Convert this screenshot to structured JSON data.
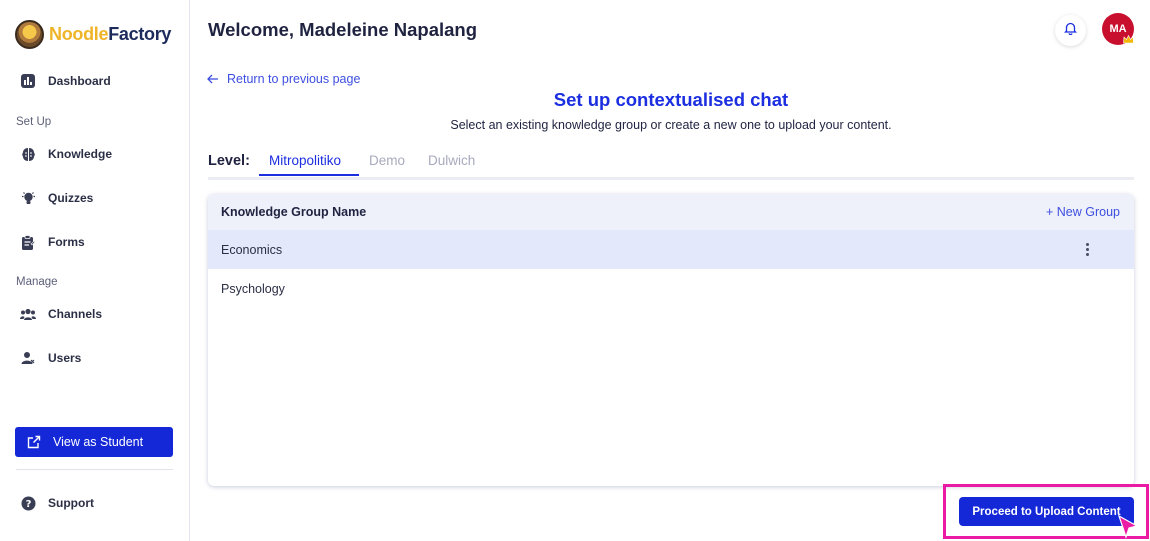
{
  "brand": {
    "name_part1": "Noodle",
    "name_part2": "Factory"
  },
  "sidebar": {
    "dashboard": "Dashboard",
    "setup_label": "Set Up",
    "knowledge": "Knowledge",
    "quizzes": "Quizzes",
    "forms": "Forms",
    "manage_label": "Manage",
    "channels": "Channels",
    "users": "Users",
    "view_as_student": "View as Student",
    "support": "Support"
  },
  "header": {
    "welcome": "Welcome, Madeleine Napalang",
    "avatar_initials": "MA"
  },
  "main": {
    "back_link": "Return to previous page",
    "title": "Set up contextualised chat",
    "subtitle": "Select an existing knowledge group or create a new one to upload your content.",
    "level_label": "Level:",
    "tabs": [
      "Mitropolitiko",
      "Demo",
      "Dulwich"
    ],
    "active_tab": "Mitropolitiko",
    "table": {
      "column_header": "Knowledge Group Name",
      "new_group": "+ New Group",
      "rows": [
        "Economics",
        "Psychology"
      ],
      "selected_row": "Economics"
    },
    "proceed_button": "Proceed to Upload Content"
  },
  "colors": {
    "accent": "#1b2ee0",
    "button": "#1428d8",
    "highlight": "#ea1aa5",
    "avatar": "#c8102e"
  }
}
